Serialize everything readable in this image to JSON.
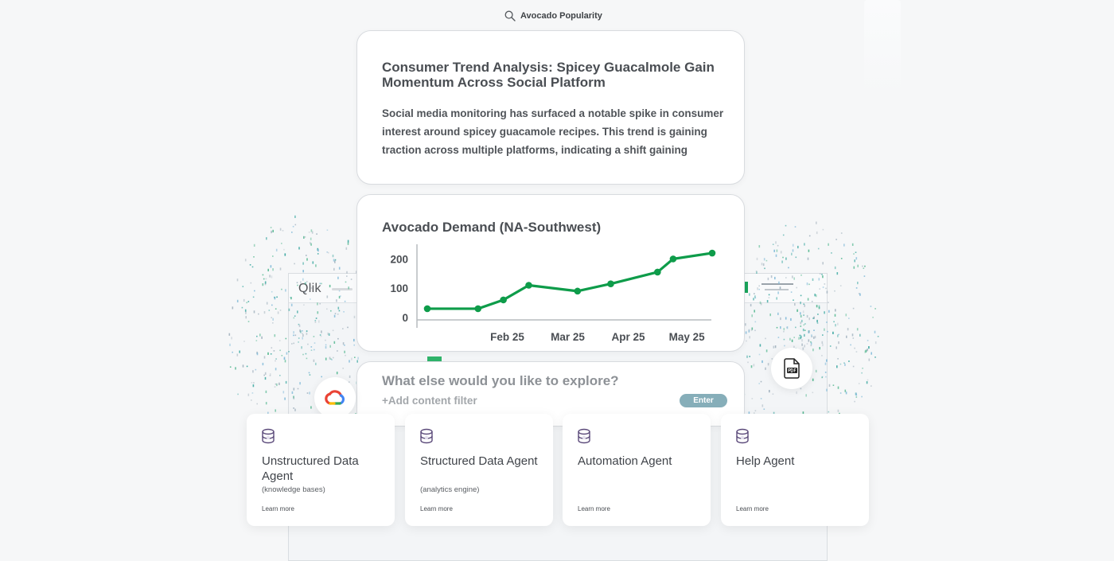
{
  "search": {
    "query": "Avocado Popularity",
    "icon": "search-icon"
  },
  "insight": {
    "title": "Consumer Trend Analysis: Spicey Guacalmole Gain Momentum Across Social Platform",
    "body": "Social media monitoring has surfaced a notable spike in consumer interest around spicey guacamole recipes. This trend is gaining traction across multiple platforms, indicating a shift gaining"
  },
  "background_app": {
    "logo": "Qlik",
    "accent": "#19a35a"
  },
  "chart_data": {
    "type": "line",
    "title": "Avocado Demand (NA-Southwest)",
    "x": [
      "2025-01-08",
      "2025-02-03",
      "2025-02-16",
      "2025-03-01",
      "2025-03-26",
      "2025-04-12",
      "2025-05-06",
      "2025-05-14",
      "2025-06-03"
    ],
    "tick_labels": [
      "Feb 25",
      "Mar 25",
      "Apr 25",
      "May 25"
    ],
    "series": [
      {
        "values": [
          30,
          30,
          60,
          110,
          90,
          115,
          155,
          200,
          220
        ],
        "color": "#0e9c4a"
      }
    ],
    "yticks": [
      0,
      100,
      200
    ],
    "ylim": [
      -30,
      250
    ],
    "grid": false
  },
  "explore": {
    "question": "What else would you like to explore?",
    "filter_label": "+Add content filter",
    "enter_label": "Enter"
  },
  "floating_icons": [
    "google-cloud-icon",
    "pdf-file-icon"
  ],
  "agents": [
    {
      "title": "Unstructured Data Agent",
      "subtitle": "(knowledge bases)",
      "link": "Learn more",
      "icon": "database-icon"
    },
    {
      "title": "Structured Data Agent",
      "subtitle": "(analytics engine)",
      "link": "Learn more",
      "icon": "database-icon"
    },
    {
      "title": "Automation Agent",
      "subtitle": "",
      "link": "Learn more",
      "icon": "database-icon"
    },
    {
      "title": "Help Agent",
      "subtitle": "",
      "link": "Learn more",
      "icon": "database-icon"
    }
  ]
}
